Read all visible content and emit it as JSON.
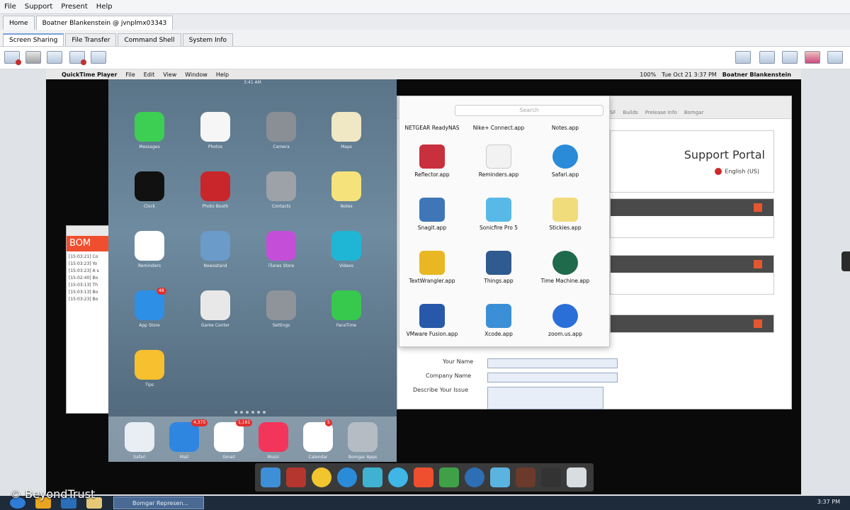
{
  "host_menu": [
    "File",
    "Support",
    "Present",
    "Help"
  ],
  "session_tabs": {
    "home": "Home",
    "session": "Boatner Blankenstein @ jvnplmx03343"
  },
  "sub_tabs": [
    "Screen Sharing",
    "File Transfer",
    "Command Shell",
    "System Info"
  ],
  "mac_menu": {
    "app": "QuickTime Player",
    "items": [
      "File",
      "Edit",
      "View",
      "Window",
      "Help"
    ],
    "battery": "100%",
    "datetime": "Tue Oct 21  3:37 PM",
    "user": "Boatner Blankenstein"
  },
  "portal": {
    "title": "Support Portal",
    "language": "English (US)",
    "bookmarks": [
      "SF",
      "Builds",
      "Prelease Info",
      "Bomgar"
    ],
    "form": {
      "name_label": "Your Name",
      "company_label": "Company Name",
      "issue_label": "Describe Your Issue"
    }
  },
  "finder": {
    "search_placeholder": "Search",
    "apps": [
      "NETGEAR ReadyNAS",
      "Nike+ Connect.app",
      "Notes.app",
      "Reflector.app",
      "Reminders.app",
      "Safari.app",
      "Snagit.app",
      "Sonicfire Pro 5",
      "Stickies.app",
      "TextWrangler.app",
      "Things.app",
      "Time Machine.app",
      "VMware Fusion.app",
      "Xcode.app",
      "zoom.us.app"
    ]
  },
  "bom_window": {
    "brand": "BOM",
    "log": [
      "[15:03:21] Co",
      "[15:03:23] Yo",
      "[15:03:23] A s",
      "[15:02:40] Bo",
      "[15:03:13] Th",
      "[15:03:13] Bo",
      "[15:03:23] Bo"
    ]
  },
  "ipad": {
    "time": "3:41 AM",
    "apps": [
      {
        "label": "Messages",
        "color": "#3ccf54"
      },
      {
        "label": "Photos",
        "color": "#f6f6f6"
      },
      {
        "label": "Camera",
        "color": "#8a8f95"
      },
      {
        "label": "Maps",
        "color": "#f0e7c4"
      },
      {
        "label": "Clock",
        "color": "#111111"
      },
      {
        "label": "Photo Booth",
        "color": "#c8262b"
      },
      {
        "label": "Contacts",
        "color": "#9da2a8"
      },
      {
        "label": "Notes",
        "color": "#f5e27a"
      },
      {
        "label": "Reminders",
        "color": "#ffffff"
      },
      {
        "label": "Newsstand",
        "color": "#6a9bc9"
      },
      {
        "label": "iTunes Store",
        "color": "#c54ed9"
      },
      {
        "label": "Videos",
        "color": "#1fb6d6"
      },
      {
        "label": "App Store",
        "color": "#2d8fe6",
        "badge": "48"
      },
      {
        "label": "Game Center",
        "color": "#e8e8e8"
      },
      {
        "label": "Settings",
        "color": "#8f949a"
      },
      {
        "label": "FaceTime",
        "color": "#37c94d"
      },
      {
        "label": "Tips",
        "color": "#f6c02e"
      }
    ],
    "dock": [
      {
        "label": "Safari",
        "color": "#e9eef4"
      },
      {
        "label": "Mail",
        "color": "#2f86e0",
        "badge": "4,375"
      },
      {
        "label": "Gmail",
        "color": "#ffffff",
        "badge": "1,181"
      },
      {
        "label": "Music",
        "color": "#f3355c"
      },
      {
        "label": "Calendar",
        "color": "#ffffff",
        "badge": "5"
      },
      {
        "label": "Bomgar Apps",
        "color": "#b6bcc4"
      }
    ]
  },
  "taskbar": {
    "window": "Bomgar Represen...",
    "clock": "3:37 PM"
  },
  "watermark": "© BeyondTrust",
  "colors": {
    "accent": "#ef4f2f",
    "taskbar": "#1e2b3b"
  }
}
